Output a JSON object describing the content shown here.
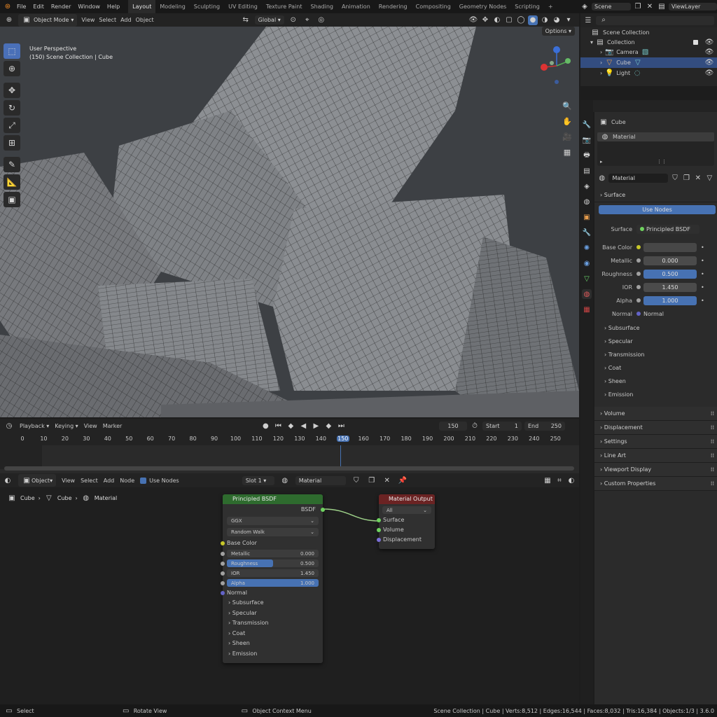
{
  "topbar": {
    "menus": [
      "File",
      "Edit",
      "Render",
      "Window",
      "Help"
    ],
    "workspaces": [
      "Layout",
      "Modeling",
      "Sculpting",
      "UV Editing",
      "Texture Paint",
      "Shading",
      "Animation",
      "Rendering",
      "Compositing",
      "Geometry Nodes",
      "Scripting"
    ],
    "active_workspace": "Layout",
    "add_tab": "+",
    "scene": "Scene",
    "view_layer": "ViewLayer"
  },
  "viewport_header": {
    "mode": "Object Mode",
    "menus": [
      "View",
      "Select",
      "Add",
      "Object"
    ],
    "transform_orientation": "Global",
    "options": "Options"
  },
  "viewport": {
    "perspective": "User Perspective",
    "collection_info": "(150) Scene Collection | Cube"
  },
  "timeline": {
    "menus": [
      "Playback",
      "Keying",
      "View",
      "Marker"
    ],
    "current_frame": "150",
    "start_label": "Start",
    "start_value": "1",
    "end_label": "End",
    "end_value": "250",
    "ruler_ticks": [
      "0",
      "10",
      "20",
      "30",
      "40",
      "50",
      "60",
      "70",
      "80",
      "90",
      "100",
      "110",
      "120",
      "130",
      "140",
      "150",
      "160",
      "170",
      "180",
      "190",
      "200",
      "210",
      "220",
      "230",
      "240",
      "250"
    ]
  },
  "node_editor_header": {
    "type": "Object",
    "menus": [
      "View",
      "Select",
      "Add",
      "Node"
    ],
    "use_nodes_label": "Use Nodes",
    "slot": "Slot 1",
    "material": "Material"
  },
  "node_editor": {
    "breadcrumb": [
      "Cube",
      "Cube",
      "Material"
    ],
    "bsdf_node": {
      "title": "Principled BSDF",
      "output": "BSDF",
      "distribution": "GGX",
      "subsurface_method": "Random Walk",
      "base_color": "Base Color",
      "fields": [
        {
          "label": "Metallic",
          "value": "0.000",
          "fill": 0.0
        },
        {
          "label": "Roughness",
          "value": "0.500",
          "fill": 0.5
        },
        {
          "label": "IOR",
          "value": "1.450",
          "fill": 0.0
        },
        {
          "label": "Alpha",
          "value": "1.000",
          "fill": 1.0
        }
      ],
      "normal": "Normal",
      "panels": [
        "Subsurface",
        "Specular",
        "Transmission",
        "Coat",
        "Sheen",
        "Emission"
      ]
    },
    "output_node": {
      "title": "Material Output",
      "target": "All",
      "inputs": [
        "Surface",
        "Volume",
        "Displacement"
      ]
    }
  },
  "outliner": {
    "root": "Scene Collection",
    "collection": "Collection",
    "items": [
      "Camera",
      "Cube",
      "Light"
    ],
    "selected": "Cube"
  },
  "properties": {
    "object_name": "Cube",
    "material_slot": "Material",
    "material_name": "Material",
    "surface_section": "Surface",
    "use_nodes_button": "Use Nodes",
    "surface_label": "Surface",
    "surface_value": "Principled BSDF",
    "base_color_label": "Base Color",
    "fields": [
      {
        "label": "Metallic",
        "value": "0.000",
        "highlight": false
      },
      {
        "label": "Roughness",
        "value": "0.500",
        "highlight": true
      },
      {
        "label": "IOR",
        "value": "1.450",
        "highlight": false
      },
      {
        "label": "Alpha",
        "value": "1.000",
        "highlight": true
      }
    ],
    "normal_label": "Normal",
    "normal_value": "Normal",
    "subpanels": [
      "Subsurface",
      "Specular",
      "Transmission",
      "Coat",
      "Sheen",
      "Emission"
    ],
    "sections": [
      "Volume",
      "Displacement",
      "Settings",
      "Line Art",
      "Viewport Display",
      "Custom Properties"
    ]
  },
  "statusbar": {
    "select": "Select",
    "rotate": "Rotate View",
    "context": "Object Context Menu",
    "stats": "Scene Collection | Cube | Verts:8,512 | Edges:16,544 | Faces:8,032 | Tris:16,384 | Objects:1/3 | 3.6.0"
  },
  "colors": {
    "accent": "#4772b3",
    "bsdf_header": "#2e6b2e",
    "output_header": "#6b2323",
    "viewport_bg": "#3c3f43"
  }
}
